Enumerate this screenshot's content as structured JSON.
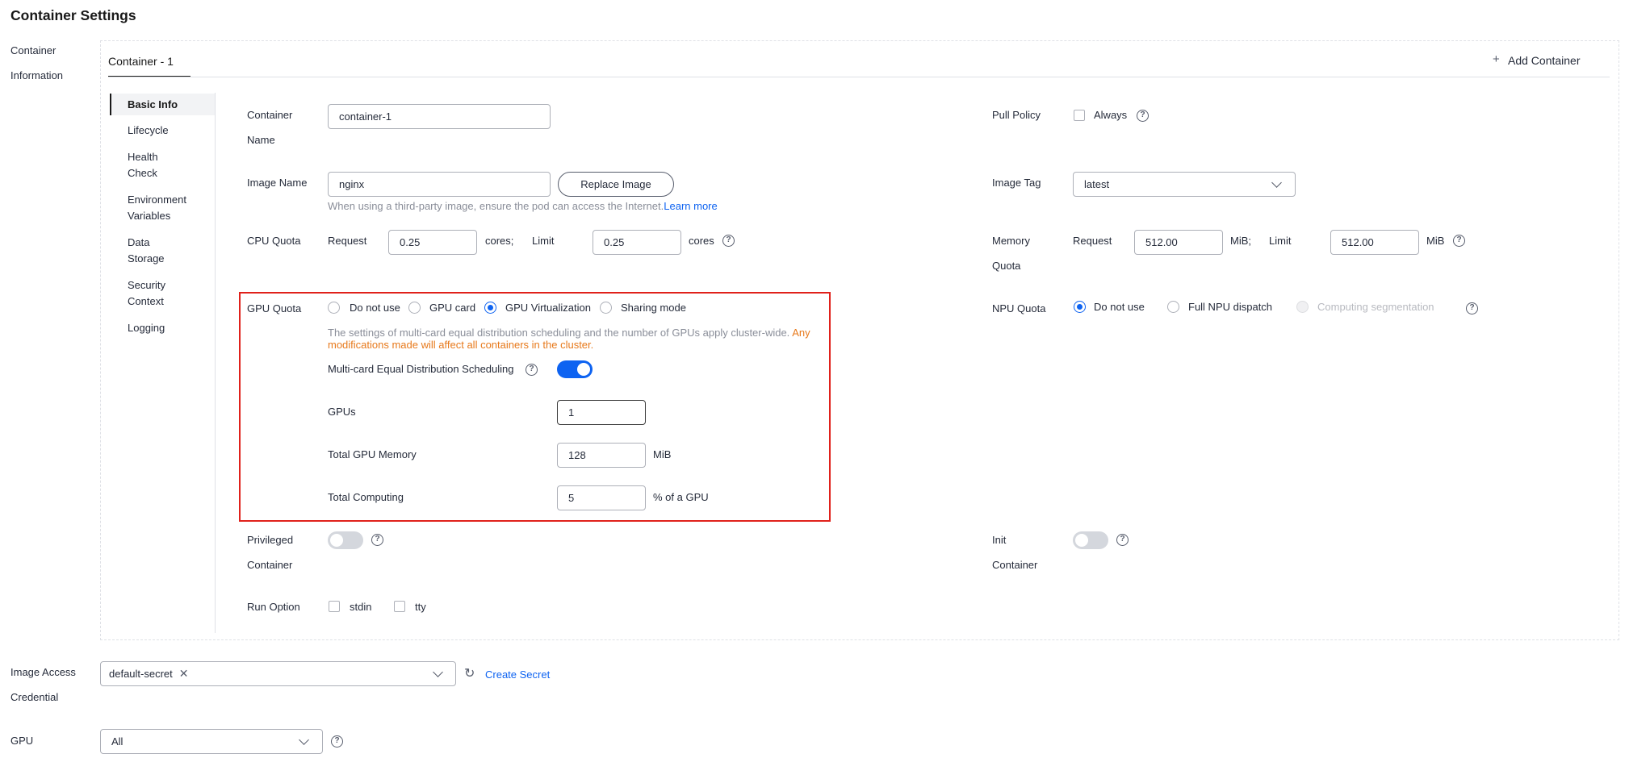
{
  "page": {
    "title": "Container Settings"
  },
  "left_labels": {
    "container_information_1": "Container",
    "container_information_2": "Information",
    "image_access_1": "Image Access",
    "image_access_2": "Credential",
    "gpu": "GPU"
  },
  "tabs": {
    "container_1": "Container - 1",
    "add_container": "Add Container"
  },
  "side_nav": {
    "basic_info": "Basic Info",
    "lifecycle": "Lifecycle",
    "health_1": "Health",
    "health_2": "Check",
    "env_1": "Environment",
    "env_2": "Variables",
    "storage_1": "Data",
    "storage_2": "Storage",
    "security_1": "Security",
    "security_2": "Context",
    "logging": "Logging"
  },
  "basic": {
    "container_name_label_1": "Container",
    "container_name_label_2": "Name",
    "container_name_value": "container-1",
    "pull_policy_label": "Pull Policy",
    "pull_policy_option": "Always",
    "image_name_label": "Image Name",
    "image_name_value": "nginx",
    "replace_image": "Replace Image",
    "image_hint": "When using a third-party image, ensure the pod can access the Internet.",
    "learn_more": "Learn more",
    "image_tag_label": "Image Tag",
    "image_tag_value": "latest",
    "cpu_label": "CPU Quota",
    "request": "Request",
    "limit": "Limit",
    "cpu_request": "0.25",
    "cpu_request_unit": "cores;",
    "cpu_limit": "0.25",
    "cpu_limit_unit": "cores",
    "mem_label_1": "Memory",
    "mem_label_2": "Quota",
    "mem_request": "512.00",
    "mem_request_unit": "MiB;",
    "mem_limit": "512.00",
    "mem_limit_unit": "MiB"
  },
  "gpu_quota": {
    "label": "GPU Quota",
    "options": [
      "Do not use",
      "GPU card",
      "GPU Virtualization",
      "Sharing mode"
    ],
    "selected": "GPU Virtualization",
    "note": "The settings of multi-card equal distribution scheduling and the number of GPUs apply cluster-wide.",
    "note_warn_1": "Any",
    "note_warn_2": "modifications made will affect all containers in the cluster.",
    "multi_card_label": "Multi-card Equal Distribution Scheduling",
    "multi_card_enabled": true,
    "gpus_label": "GPUs",
    "gpus_value": "1",
    "memory_label": "Total GPU Memory",
    "memory_value": "128",
    "memory_unit": "MiB",
    "computing_label": "Total Computing",
    "computing_value": "5",
    "computing_unit": "% of a GPU"
  },
  "npu_quota": {
    "label": "NPU Quota",
    "options": [
      "Do not use",
      "Full NPU dispatch",
      "Computing segmentation"
    ],
    "selected": "Do not use"
  },
  "privileged": {
    "label_1": "Privileged",
    "label_2": "Container",
    "enabled": false
  },
  "init": {
    "label_1": "Init",
    "label_2": "Container",
    "enabled": false
  },
  "run_option": {
    "label": "Run Option",
    "stdin": "stdin",
    "tty": "tty"
  },
  "image_access": {
    "tag": "default-secret",
    "create_secret": "Create Secret"
  },
  "gpu_select": {
    "value": "All"
  },
  "colors": {
    "accent": "#0e63f1",
    "highlight_border": "#e0211b",
    "warning": "#e7791b"
  }
}
